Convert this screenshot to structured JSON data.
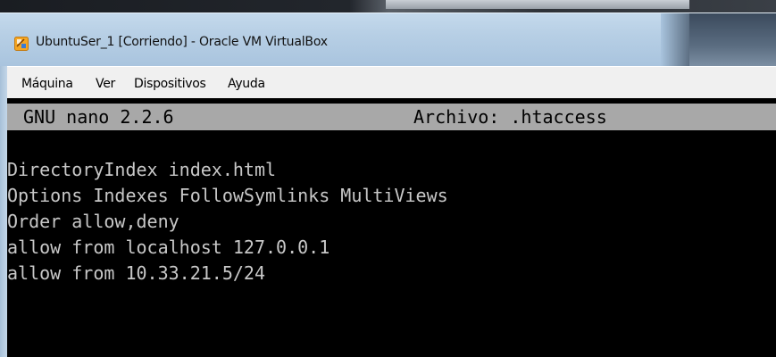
{
  "window": {
    "title": "UbuntuSer_1 [Corriendo] - Oracle VM VirtualBox",
    "app_icon": "virtualbox-icon"
  },
  "menubar": {
    "items": [
      {
        "label": "Máquina"
      },
      {
        "label": "Ver"
      },
      {
        "label": "Dispositivos"
      },
      {
        "label": "Ayuda"
      }
    ]
  },
  "nano": {
    "version": "GNU nano 2.2.6",
    "file_label": "Archivo: .htaccess",
    "lines": [
      "DirectoryIndex index.html",
      "Options Indexes FollowSymlinks MultiViews",
      "Order allow,deny",
      "allow from localhost 127.0.0.1",
      "allow from 10.33.21.5/24"
    ]
  },
  "colors": {
    "terminal_bg": "#000000",
    "terminal_fg": "#c8c8c8",
    "nano_header_bg": "#a8a8a8",
    "titlebar": "#b7cfe5",
    "menubar": "#f0f0f0"
  }
}
